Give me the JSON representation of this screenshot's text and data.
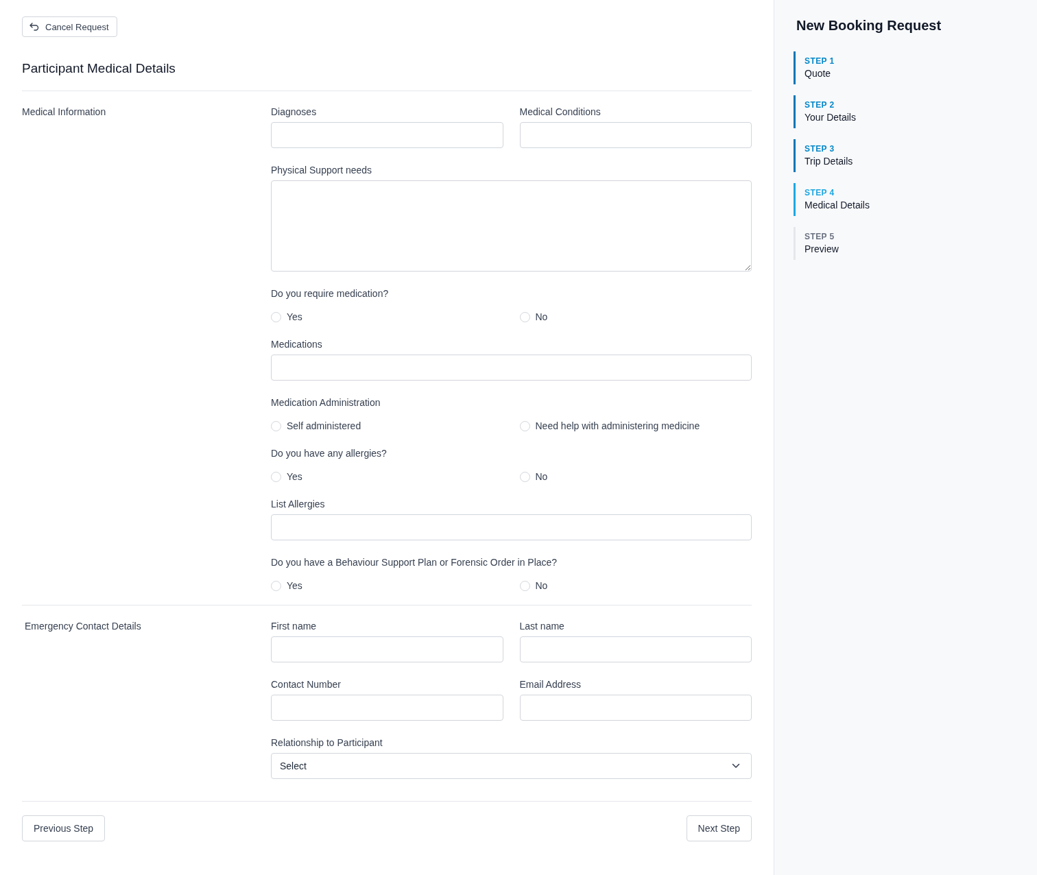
{
  "cancel_button": {
    "label": "Cancel Request"
  },
  "page_title": "Participant Medical Details",
  "sections": [
    {
      "title": "Medical Information",
      "rows": [
        {
          "fields": [
            {
              "kind": "input",
              "label": "Diagnoses"
            },
            {
              "kind": "input",
              "label": "Medical Conditions"
            }
          ]
        },
        {
          "fields": [
            {
              "kind": "textarea",
              "label": "Physical Support needs"
            }
          ]
        },
        {
          "fields": [
            {
              "kind": "radio",
              "label": "Do you require medication?",
              "options": [
                {
                  "label": "Yes",
                  "selected": false
                },
                {
                  "label": "No",
                  "selected": false
                }
              ]
            }
          ]
        },
        {
          "fields": [
            {
              "kind": "input",
              "label": "Medications"
            }
          ]
        },
        {
          "fields": [
            {
              "kind": "radio",
              "label": "Medication Administration",
              "options": [
                {
                  "label": "Self administered",
                  "selected": false
                },
                {
                  "label": "Need help with administering medicine",
                  "selected": false
                }
              ]
            }
          ]
        },
        {
          "fields": [
            {
              "kind": "radio",
              "label": "Do you have any allergies?",
              "options": [
                {
                  "label": "Yes",
                  "selected": false
                },
                {
                  "label": "No",
                  "selected": false
                }
              ]
            }
          ]
        },
        {
          "fields": [
            {
              "kind": "input",
              "label": "List Allergies"
            }
          ]
        },
        {
          "fields": [
            {
              "kind": "radio",
              "label": "Do you have a Behaviour Support Plan or Forensic Order in Place?",
              "options": [
                {
                  "label": "Yes",
                  "selected": false
                },
                {
                  "label": "No",
                  "selected": false
                }
              ]
            }
          ]
        }
      ]
    },
    {
      "title": "Emergency Contact Details",
      "rows": [
        {
          "fields": [
            {
              "kind": "input",
              "label": "First name"
            },
            {
              "kind": "input",
              "label": "Last name"
            }
          ]
        },
        {
          "fields": [
            {
              "kind": "input",
              "label": "Contact Number"
            },
            {
              "kind": "input",
              "label": "Email Address"
            }
          ]
        },
        {
          "fields": [
            {
              "kind": "select",
              "label": "Relationship to Participant",
              "placeholder": "Select"
            }
          ]
        }
      ]
    }
  ],
  "footer": {
    "previous": "Previous Step",
    "next": "Next Step"
  },
  "sidebar": {
    "title": "New Booking Request",
    "steps": [
      {
        "step": "STEP 1",
        "name": "Quote",
        "completed": true,
        "selected": false
      },
      {
        "step": "STEP 2",
        "name": "Your Details",
        "completed": true,
        "selected": false
      },
      {
        "step": "STEP 3",
        "name": "Trip Details",
        "completed": true,
        "selected": false
      },
      {
        "step": "STEP 4",
        "name": "Medical Details",
        "completed": false,
        "selected": true
      },
      {
        "step": "STEP 5",
        "name": "Preview",
        "completed": false,
        "selected": false
      }
    ]
  }
}
